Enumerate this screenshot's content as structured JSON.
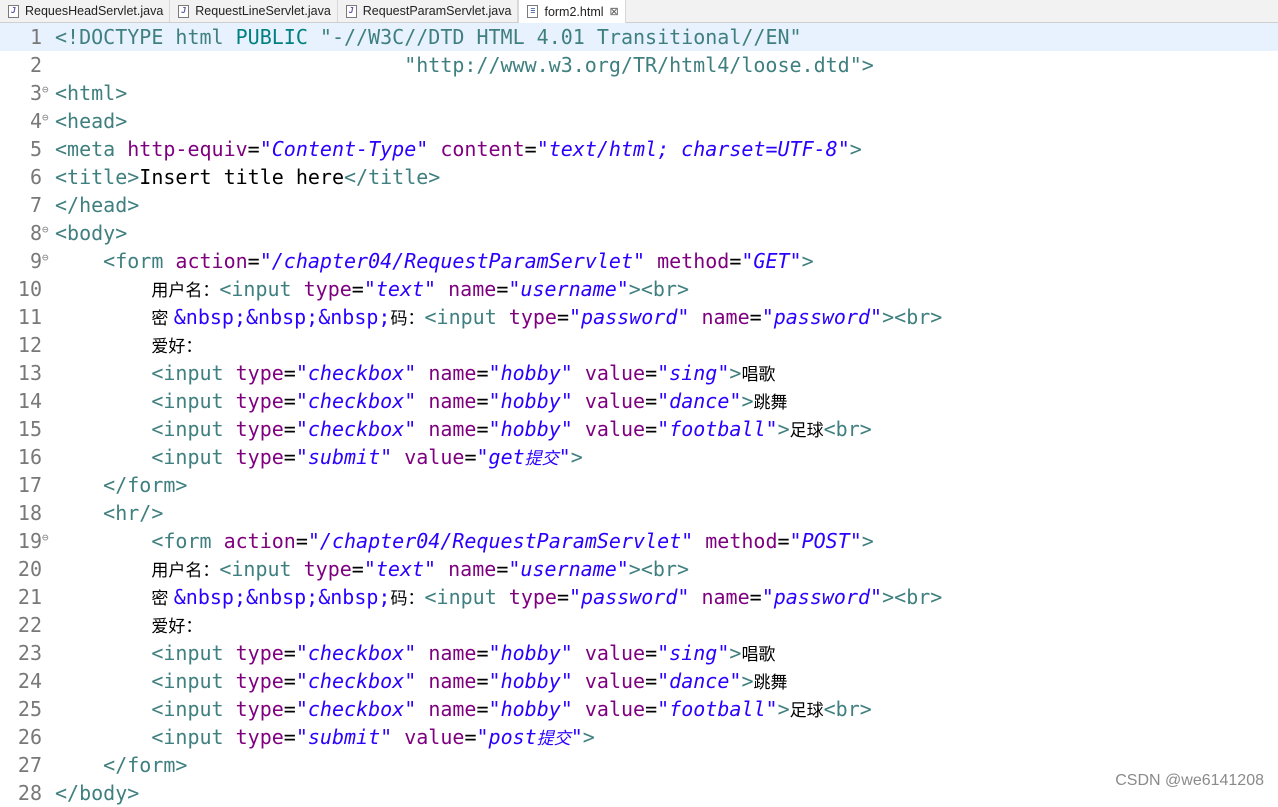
{
  "tabs": [
    {
      "label": "RequesHeadServlet.java",
      "icon": "java-file-icon"
    },
    {
      "label": "RequestLineServlet.java",
      "icon": "java-file-icon"
    },
    {
      "label": "RequestParamServlet.java",
      "icon": "java-file-icon"
    },
    {
      "label": "form2.html",
      "icon": "html-file-icon",
      "active": true,
      "close": "⊠"
    }
  ],
  "lines": [
    {
      "n": "1",
      "fold": "",
      "hl": true,
      "segs": [
        [
          "tag",
          "<!DOCTYPE html "
        ],
        [
          "doc",
          "PUBLIC "
        ],
        [
          "tag",
          "\"-//W3C//DTD HTML 4.01 Transitional//EN\""
        ]
      ]
    },
    {
      "n": "2",
      "fold": "",
      "segs": [
        [
          "tag",
          "                             \"http://www.w3.org/TR/html4/loose.dtd\">"
        ]
      ]
    },
    {
      "n": "3",
      "fold": "⊖",
      "segs": [
        [
          "tag",
          "<html>"
        ]
      ]
    },
    {
      "n": "4",
      "fold": "⊖",
      "segs": [
        [
          "tag",
          "<head>"
        ]
      ]
    },
    {
      "n": "5",
      "fold": "",
      "segs": [
        [
          "tag",
          "<meta "
        ],
        [
          "att",
          "http-equiv"
        ],
        [
          "txt",
          "="
        ],
        [
          "val",
          "\"Content-Type\""
        ],
        [
          "txt",
          " "
        ],
        [
          "att",
          "content"
        ],
        [
          "txt",
          "="
        ],
        [
          "val",
          "\"text/html; charset=UTF-8\""
        ],
        [
          "tag",
          ">"
        ]
      ]
    },
    {
      "n": "6",
      "fold": "",
      "segs": [
        [
          "tag",
          "<title>"
        ],
        [
          "txt",
          "Insert title here"
        ],
        [
          "tag",
          "</title>"
        ]
      ]
    },
    {
      "n": "7",
      "fold": "",
      "segs": [
        [
          "tag",
          "</head>"
        ]
      ]
    },
    {
      "n": "8",
      "fold": "⊖",
      "segs": [
        [
          "tag",
          "<body>"
        ]
      ]
    },
    {
      "n": "9",
      "fold": "⊖",
      "segs": [
        [
          "txt",
          "    "
        ],
        [
          "tag",
          "<form "
        ],
        [
          "att",
          "action"
        ],
        [
          "txt",
          "="
        ],
        [
          "val",
          "\"/chapter04/RequestParamServlet\""
        ],
        [
          "txt",
          " "
        ],
        [
          "att",
          "method"
        ],
        [
          "txt",
          "="
        ],
        [
          "val",
          "\"GET\""
        ],
        [
          "tag",
          ">"
        ]
      ]
    },
    {
      "n": "10",
      "fold": "",
      "segs": [
        [
          "txt",
          "        "
        ],
        [
          "cjk",
          "用户名："
        ],
        [
          "tag",
          "<input "
        ],
        [
          "att",
          "type"
        ],
        [
          "txt",
          "="
        ],
        [
          "val",
          "\"text\""
        ],
        [
          "txt",
          " "
        ],
        [
          "att",
          "name"
        ],
        [
          "txt",
          "="
        ],
        [
          "val",
          "\"username\""
        ],
        [
          "tag",
          "><br>"
        ]
      ]
    },
    {
      "n": "11",
      "fold": "",
      "segs": [
        [
          "txt",
          "        "
        ],
        [
          "cjk",
          "密 "
        ],
        [
          "val2",
          "&nbsp;&nbsp;&nbsp;"
        ],
        [
          "cjk",
          "码："
        ],
        [
          "tag",
          "<input "
        ],
        [
          "att",
          "type"
        ],
        [
          "txt",
          "="
        ],
        [
          "val",
          "\"password\""
        ],
        [
          "txt",
          " "
        ],
        [
          "att",
          "name"
        ],
        [
          "txt",
          "="
        ],
        [
          "val",
          "\"password\""
        ],
        [
          "tag",
          "><br>"
        ]
      ]
    },
    {
      "n": "12",
      "fold": "",
      "segs": [
        [
          "txt",
          "        "
        ],
        [
          "cjk",
          "爱好："
        ]
      ]
    },
    {
      "n": "13",
      "fold": "",
      "segs": [
        [
          "txt",
          "        "
        ],
        [
          "tag",
          "<input "
        ],
        [
          "att",
          "type"
        ],
        [
          "txt",
          "="
        ],
        [
          "val",
          "\"checkbox\""
        ],
        [
          "txt",
          " "
        ],
        [
          "att",
          "name"
        ],
        [
          "txt",
          "="
        ],
        [
          "val",
          "\"hobby\""
        ],
        [
          "txt",
          " "
        ],
        [
          "att",
          "value"
        ],
        [
          "txt",
          "="
        ],
        [
          "val",
          "\"sing\""
        ],
        [
          "tag",
          ">"
        ],
        [
          "cjk",
          "唱歌"
        ]
      ]
    },
    {
      "n": "14",
      "fold": "",
      "segs": [
        [
          "txt",
          "        "
        ],
        [
          "tag",
          "<input "
        ],
        [
          "att",
          "type"
        ],
        [
          "txt",
          "="
        ],
        [
          "val",
          "\"checkbox\""
        ],
        [
          "txt",
          " "
        ],
        [
          "att",
          "name"
        ],
        [
          "txt",
          "="
        ],
        [
          "val",
          "\"hobby\""
        ],
        [
          "txt",
          " "
        ],
        [
          "att",
          "value"
        ],
        [
          "txt",
          "="
        ],
        [
          "val",
          "\"dance\""
        ],
        [
          "tag",
          ">"
        ],
        [
          "cjk",
          "跳舞"
        ]
      ]
    },
    {
      "n": "15",
      "fold": "",
      "segs": [
        [
          "txt",
          "        "
        ],
        [
          "tag",
          "<input "
        ],
        [
          "att",
          "type"
        ],
        [
          "txt",
          "="
        ],
        [
          "val",
          "\"checkbox\""
        ],
        [
          "txt",
          " "
        ],
        [
          "att",
          "name"
        ],
        [
          "txt",
          "="
        ],
        [
          "val",
          "\"hobby\""
        ],
        [
          "txt",
          " "
        ],
        [
          "att",
          "value"
        ],
        [
          "txt",
          "="
        ],
        [
          "val",
          "\"football\""
        ],
        [
          "tag",
          ">"
        ],
        [
          "cjk",
          "足球"
        ],
        [
          "tag",
          "<br>"
        ]
      ]
    },
    {
      "n": "16",
      "fold": "",
      "segs": [
        [
          "txt",
          "        "
        ],
        [
          "tag",
          "<input "
        ],
        [
          "att",
          "type"
        ],
        [
          "txt",
          "="
        ],
        [
          "val",
          "\"submit\""
        ],
        [
          "txt",
          " "
        ],
        [
          "att",
          "value"
        ],
        [
          "txt",
          "="
        ],
        [
          "val",
          "\"get"
        ],
        [
          "cjkval",
          "提交"
        ],
        [
          "val",
          "\""
        ],
        [
          "tag",
          ">"
        ]
      ]
    },
    {
      "n": "17",
      "fold": "",
      "segs": [
        [
          "txt",
          "    "
        ],
        [
          "tag",
          "</form>"
        ]
      ]
    },
    {
      "n": "18",
      "fold": "",
      "segs": [
        [
          "txt",
          "    "
        ],
        [
          "tag",
          "<hr/>"
        ]
      ]
    },
    {
      "n": "19",
      "fold": "⊖",
      "segs": [
        [
          "txt",
          "        "
        ],
        [
          "tag",
          "<form "
        ],
        [
          "att",
          "action"
        ],
        [
          "txt",
          "="
        ],
        [
          "val",
          "\"/chapter04/RequestParamServlet\""
        ],
        [
          "txt",
          " "
        ],
        [
          "att",
          "method"
        ],
        [
          "txt",
          "="
        ],
        [
          "val",
          "\"POST\""
        ],
        [
          "tag",
          ">"
        ]
      ]
    },
    {
      "n": "20",
      "fold": "",
      "segs": [
        [
          "txt",
          "        "
        ],
        [
          "cjk",
          "用户名："
        ],
        [
          "tag",
          "<input "
        ],
        [
          "att",
          "type"
        ],
        [
          "txt",
          "="
        ],
        [
          "val",
          "\"text\""
        ],
        [
          "txt",
          " "
        ],
        [
          "att",
          "name"
        ],
        [
          "txt",
          "="
        ],
        [
          "val",
          "\"username\""
        ],
        [
          "tag",
          "><br>"
        ]
      ]
    },
    {
      "n": "21",
      "fold": "",
      "segs": [
        [
          "txt",
          "        "
        ],
        [
          "cjk",
          "密 "
        ],
        [
          "val2",
          "&nbsp;&nbsp;&nbsp;"
        ],
        [
          "cjk",
          "码："
        ],
        [
          "tag",
          "<input "
        ],
        [
          "att",
          "type"
        ],
        [
          "txt",
          "="
        ],
        [
          "val",
          "\"password\""
        ],
        [
          "txt",
          " "
        ],
        [
          "att",
          "name"
        ],
        [
          "txt",
          "="
        ],
        [
          "val",
          "\"password\""
        ],
        [
          "tag",
          "><br>"
        ]
      ]
    },
    {
      "n": "22",
      "fold": "",
      "segs": [
        [
          "txt",
          "        "
        ],
        [
          "cjk",
          "爱好："
        ]
      ]
    },
    {
      "n": "23",
      "fold": "",
      "segs": [
        [
          "txt",
          "        "
        ],
        [
          "tag",
          "<input "
        ],
        [
          "att",
          "type"
        ],
        [
          "txt",
          "="
        ],
        [
          "val",
          "\"checkbox\""
        ],
        [
          "txt",
          " "
        ],
        [
          "att",
          "name"
        ],
        [
          "txt",
          "="
        ],
        [
          "val",
          "\"hobby\""
        ],
        [
          "txt",
          " "
        ],
        [
          "att",
          "value"
        ],
        [
          "txt",
          "="
        ],
        [
          "val",
          "\"sing\""
        ],
        [
          "tag",
          ">"
        ],
        [
          "cjk",
          "唱歌"
        ]
      ]
    },
    {
      "n": "24",
      "fold": "",
      "segs": [
        [
          "txt",
          "        "
        ],
        [
          "tag",
          "<input "
        ],
        [
          "att",
          "type"
        ],
        [
          "txt",
          "="
        ],
        [
          "val",
          "\"checkbox\""
        ],
        [
          "txt",
          " "
        ],
        [
          "att",
          "name"
        ],
        [
          "txt",
          "="
        ],
        [
          "val",
          "\"hobby\""
        ],
        [
          "txt",
          " "
        ],
        [
          "att",
          "value"
        ],
        [
          "txt",
          "="
        ],
        [
          "val",
          "\"dance\""
        ],
        [
          "tag",
          ">"
        ],
        [
          "cjk",
          "跳舞"
        ]
      ]
    },
    {
      "n": "25",
      "fold": "",
      "segs": [
        [
          "txt",
          "        "
        ],
        [
          "tag",
          "<input "
        ],
        [
          "att",
          "type"
        ],
        [
          "txt",
          "="
        ],
        [
          "val",
          "\"checkbox\""
        ],
        [
          "txt",
          " "
        ],
        [
          "att",
          "name"
        ],
        [
          "txt",
          "="
        ],
        [
          "val",
          "\"hobby\""
        ],
        [
          "txt",
          " "
        ],
        [
          "att",
          "value"
        ],
        [
          "txt",
          "="
        ],
        [
          "val",
          "\"football\""
        ],
        [
          "tag",
          ">"
        ],
        [
          "cjk",
          "足球"
        ],
        [
          "tag",
          "<br>"
        ]
      ]
    },
    {
      "n": "26",
      "fold": "",
      "segs": [
        [
          "txt",
          "        "
        ],
        [
          "tag",
          "<input "
        ],
        [
          "att",
          "type"
        ],
        [
          "txt",
          "="
        ],
        [
          "val",
          "\"submit\""
        ],
        [
          "txt",
          " "
        ],
        [
          "att",
          "value"
        ],
        [
          "txt",
          "="
        ],
        [
          "val",
          "\"post"
        ],
        [
          "cjkval",
          "提交"
        ],
        [
          "val",
          "\""
        ],
        [
          "tag",
          ">"
        ]
      ]
    },
    {
      "n": "27",
      "fold": "",
      "segs": [
        [
          "txt",
          "    "
        ],
        [
          "tag",
          "</form>"
        ]
      ]
    },
    {
      "n": "28",
      "fold": "",
      "segs": [
        [
          "tag",
          "</body>"
        ]
      ]
    }
  ],
  "watermark": "CSDN @we6141208"
}
